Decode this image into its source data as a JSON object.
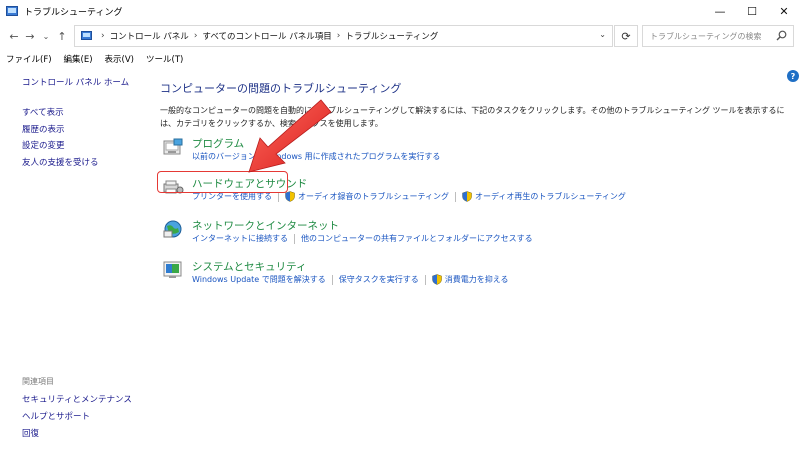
{
  "window": {
    "title": "トラブルシューティング",
    "controls": [
      "—",
      "☐",
      "✕"
    ]
  },
  "address": {
    "crumbs": [
      "コントロール パネル",
      "すべてのコントロール パネル項目",
      "トラブルシューティング"
    ],
    "search_placeholder": "トラブルシューティングの検索"
  },
  "menu": [
    "ファイル(F)",
    "編集(E)",
    "表示(V)",
    "ツール(T)"
  ],
  "sidebar": {
    "home": "コントロール パネル ホーム",
    "items": [
      "すべて表示",
      "履歴の表示",
      "設定の変更",
      "友人の支援を受ける"
    ]
  },
  "related": {
    "heading": "関連項目",
    "items": [
      "セキュリティとメンテナンス",
      "ヘルプとサポート",
      "回復"
    ]
  },
  "main": {
    "title": "コンピューターの問題のトラブルシューティング",
    "description": "一般的なコンピューターの問題を自動的にトラブルシューティングして解決するには、下記のタスクをクリックします。その他のトラブルシューティング ツールを表示するには、カテゴリをクリックするか、検索ボックスを使用します。"
  },
  "categories": [
    {
      "name": "プログラム",
      "links": [
        "以前のバージョンの Windows 用に作成されたプログラムを実行する"
      ]
    },
    {
      "name": "ハードウェアとサウンド",
      "links": [
        "プリンターを使用する",
        "オーディオ録音のトラブルシューティング",
        "オーディオ再生のトラブルシューティング"
      ]
    },
    {
      "name": "ネットワークとインターネット",
      "links": [
        "インターネットに接続する",
        "他のコンピューターの共有ファイルとフォルダーにアクセスする"
      ]
    },
    {
      "name": "システムとセキュリティ",
      "links": [
        "Windows Update で問題を解決する",
        "保守タスクを実行する",
        "消費電力を抑える"
      ]
    }
  ],
  "colors": {
    "link": "#1a55c0",
    "category": "#1e8a42",
    "title": "#1e3287",
    "highlight": "#e53935"
  }
}
